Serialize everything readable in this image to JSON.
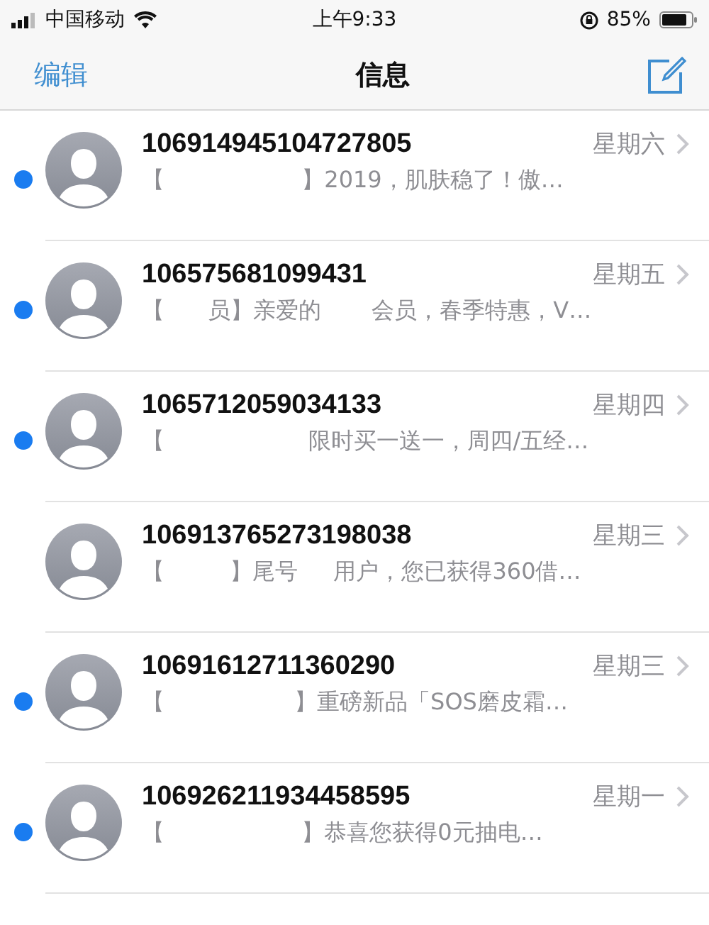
{
  "status_bar": {
    "carrier": "中国移动",
    "time": "上午9:33",
    "battery": "85%"
  },
  "nav": {
    "edit": "编辑",
    "title": "信息"
  },
  "conversations": [
    {
      "sender": "106914945104727805",
      "date": "星期六",
      "preview": "【                   】2019，肌肤稳了！傲…",
      "unread": true
    },
    {
      "sender": "106575681099431",
      "date": "星期五",
      "preview": "【      员】亲爱的       会员，春季特惠，V…",
      "unread": true
    },
    {
      "sender": "1065712059034133",
      "date": "星期四",
      "preview": "【                    限时买一送一，周四/五经…",
      "unread": true
    },
    {
      "sender": "106913765273198038",
      "date": "星期三",
      "preview": "【         】尾号     用户，您已获得360借…",
      "unread": false
    },
    {
      "sender": "10691612711360290",
      "date": "星期三",
      "preview": "【                  】重磅新品「SOS磨皮霜…",
      "unread": true
    },
    {
      "sender": "106926211934458595",
      "date": "星期一",
      "preview": "【                   】恭喜您获得0元抽电…",
      "unread": true
    }
  ]
}
